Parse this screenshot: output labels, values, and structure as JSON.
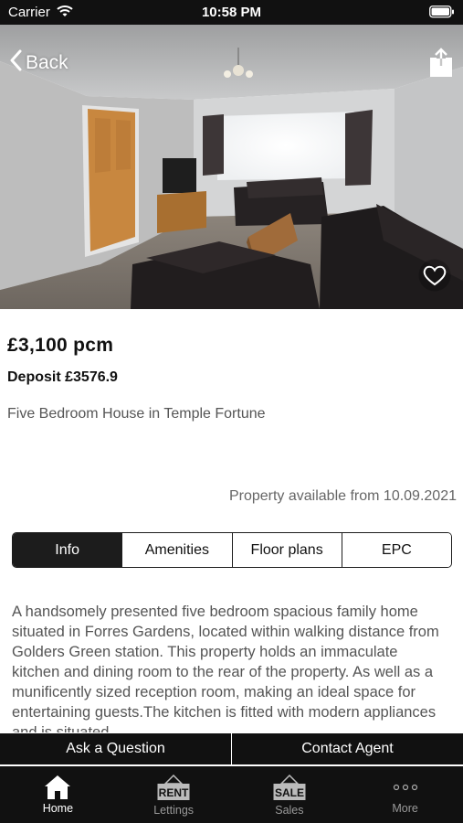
{
  "status_bar": {
    "carrier": "Carrier",
    "time": "10:58 PM"
  },
  "header": {
    "back_label": "Back"
  },
  "listing": {
    "price": "£3,100 pcm",
    "deposit": "Deposit £3576.9",
    "title": "Five Bedroom House in Temple Fortune",
    "availability": "Property available from 10.09.2021"
  },
  "tabs": [
    {
      "label": "Info",
      "active": true
    },
    {
      "label": "Amenities",
      "active": false
    },
    {
      "label": "Floor plans",
      "active": false
    },
    {
      "label": "EPC",
      "active": false
    }
  ],
  "description": "A handsomely presented five bedroom spacious family home situated in Forres Gardens, located within walking distance from Golders Green station. This property holds an immaculate kitchen and dining room to the rear of the property. As well as a munificently sized reception room, making an ideal space for entertaining guests.The kitchen is fitted with modern appliances and is situated",
  "actions": {
    "ask_question": "Ask a Question",
    "contact_agent": "Contact Agent"
  },
  "tab_bar": {
    "items": [
      {
        "label": "Home",
        "icon": "home-icon",
        "active": true
      },
      {
        "label": "Lettings",
        "icon": "rent-sign-icon",
        "active": false,
        "sign_text": "RENT"
      },
      {
        "label": "Sales",
        "icon": "sale-sign-icon",
        "active": false,
        "sign_text": "SALE"
      },
      {
        "label": "More",
        "icon": "more-dots-icon",
        "active": false
      }
    ]
  },
  "colors": {
    "dark": "#111111",
    "text_grey": "#555555",
    "accent_white": "#ffffff"
  }
}
